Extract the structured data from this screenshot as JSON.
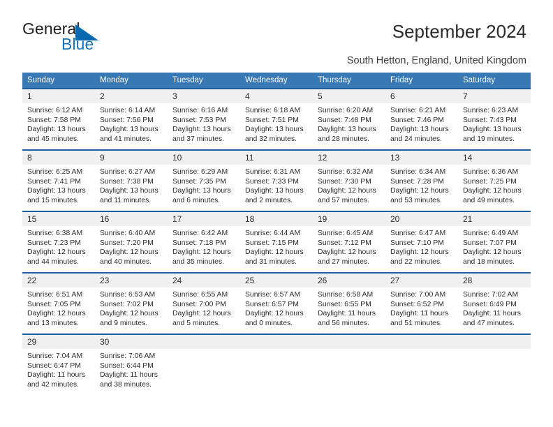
{
  "logo": {
    "word1": "General",
    "word2": "Blue",
    "icon": "triangle-icon"
  },
  "header": {
    "title": "September 2024",
    "subtitle": "South Hetton, England, United Kingdom"
  },
  "colors": {
    "header_blue": "#3878b4",
    "cell_border_blue": "#1c5f9e",
    "daynum_bg": "#f0f0f0",
    "logo_blue": "#1473bf",
    "text": "#2b2b2b"
  },
  "weekday_headers": [
    "Sunday",
    "Monday",
    "Tuesday",
    "Wednesday",
    "Thursday",
    "Friday",
    "Saturday"
  ],
  "labels": {
    "sunrise": "Sunrise:",
    "sunset": "Sunset:",
    "daylight": "Daylight:"
  },
  "weeks": [
    [
      {
        "day": "1",
        "sunrise": "Sunrise: 6:12 AM",
        "sunset": "Sunset: 7:58 PM",
        "daylight1": "Daylight: 13 hours",
        "daylight2": "and 45 minutes."
      },
      {
        "day": "2",
        "sunrise": "Sunrise: 6:14 AM",
        "sunset": "Sunset: 7:56 PM",
        "daylight1": "Daylight: 13 hours",
        "daylight2": "and 41 minutes."
      },
      {
        "day": "3",
        "sunrise": "Sunrise: 6:16 AM",
        "sunset": "Sunset: 7:53 PM",
        "daylight1": "Daylight: 13 hours",
        "daylight2": "and 37 minutes."
      },
      {
        "day": "4",
        "sunrise": "Sunrise: 6:18 AM",
        "sunset": "Sunset: 7:51 PM",
        "daylight1": "Daylight: 13 hours",
        "daylight2": "and 32 minutes."
      },
      {
        "day": "5",
        "sunrise": "Sunrise: 6:20 AM",
        "sunset": "Sunset: 7:48 PM",
        "daylight1": "Daylight: 13 hours",
        "daylight2": "and 28 minutes."
      },
      {
        "day": "6",
        "sunrise": "Sunrise: 6:21 AM",
        "sunset": "Sunset: 7:46 PM",
        "daylight1": "Daylight: 13 hours",
        "daylight2": "and 24 minutes."
      },
      {
        "day": "7",
        "sunrise": "Sunrise: 6:23 AM",
        "sunset": "Sunset: 7:43 PM",
        "daylight1": "Daylight: 13 hours",
        "daylight2": "and 19 minutes."
      }
    ],
    [
      {
        "day": "8",
        "sunrise": "Sunrise: 6:25 AM",
        "sunset": "Sunset: 7:41 PM",
        "daylight1": "Daylight: 13 hours",
        "daylight2": "and 15 minutes."
      },
      {
        "day": "9",
        "sunrise": "Sunrise: 6:27 AM",
        "sunset": "Sunset: 7:38 PM",
        "daylight1": "Daylight: 13 hours",
        "daylight2": "and 11 minutes."
      },
      {
        "day": "10",
        "sunrise": "Sunrise: 6:29 AM",
        "sunset": "Sunset: 7:35 PM",
        "daylight1": "Daylight: 13 hours",
        "daylight2": "and 6 minutes."
      },
      {
        "day": "11",
        "sunrise": "Sunrise: 6:31 AM",
        "sunset": "Sunset: 7:33 PM",
        "daylight1": "Daylight: 13 hours",
        "daylight2": "and 2 minutes."
      },
      {
        "day": "12",
        "sunrise": "Sunrise: 6:32 AM",
        "sunset": "Sunset: 7:30 PM",
        "daylight1": "Daylight: 12 hours",
        "daylight2": "and 57 minutes."
      },
      {
        "day": "13",
        "sunrise": "Sunrise: 6:34 AM",
        "sunset": "Sunset: 7:28 PM",
        "daylight1": "Daylight: 12 hours",
        "daylight2": "and 53 minutes."
      },
      {
        "day": "14",
        "sunrise": "Sunrise: 6:36 AM",
        "sunset": "Sunset: 7:25 PM",
        "daylight1": "Daylight: 12 hours",
        "daylight2": "and 49 minutes."
      }
    ],
    [
      {
        "day": "15",
        "sunrise": "Sunrise: 6:38 AM",
        "sunset": "Sunset: 7:23 PM",
        "daylight1": "Daylight: 12 hours",
        "daylight2": "and 44 minutes."
      },
      {
        "day": "16",
        "sunrise": "Sunrise: 6:40 AM",
        "sunset": "Sunset: 7:20 PM",
        "daylight1": "Daylight: 12 hours",
        "daylight2": "and 40 minutes."
      },
      {
        "day": "17",
        "sunrise": "Sunrise: 6:42 AM",
        "sunset": "Sunset: 7:18 PM",
        "daylight1": "Daylight: 12 hours",
        "daylight2": "and 35 minutes."
      },
      {
        "day": "18",
        "sunrise": "Sunrise: 6:44 AM",
        "sunset": "Sunset: 7:15 PM",
        "daylight1": "Daylight: 12 hours",
        "daylight2": "and 31 minutes."
      },
      {
        "day": "19",
        "sunrise": "Sunrise: 6:45 AM",
        "sunset": "Sunset: 7:12 PM",
        "daylight1": "Daylight: 12 hours",
        "daylight2": "and 27 minutes."
      },
      {
        "day": "20",
        "sunrise": "Sunrise: 6:47 AM",
        "sunset": "Sunset: 7:10 PM",
        "daylight1": "Daylight: 12 hours",
        "daylight2": "and 22 minutes."
      },
      {
        "day": "21",
        "sunrise": "Sunrise: 6:49 AM",
        "sunset": "Sunset: 7:07 PM",
        "daylight1": "Daylight: 12 hours",
        "daylight2": "and 18 minutes."
      }
    ],
    [
      {
        "day": "22",
        "sunrise": "Sunrise: 6:51 AM",
        "sunset": "Sunset: 7:05 PM",
        "daylight1": "Daylight: 12 hours",
        "daylight2": "and 13 minutes."
      },
      {
        "day": "23",
        "sunrise": "Sunrise: 6:53 AM",
        "sunset": "Sunset: 7:02 PM",
        "daylight1": "Daylight: 12 hours",
        "daylight2": "and 9 minutes."
      },
      {
        "day": "24",
        "sunrise": "Sunrise: 6:55 AM",
        "sunset": "Sunset: 7:00 PM",
        "daylight1": "Daylight: 12 hours",
        "daylight2": "and 5 minutes."
      },
      {
        "day": "25",
        "sunrise": "Sunrise: 6:57 AM",
        "sunset": "Sunset: 6:57 PM",
        "daylight1": "Daylight: 12 hours",
        "daylight2": "and 0 minutes."
      },
      {
        "day": "26",
        "sunrise": "Sunrise: 6:58 AM",
        "sunset": "Sunset: 6:55 PM",
        "daylight1": "Daylight: 11 hours",
        "daylight2": "and 56 minutes."
      },
      {
        "day": "27",
        "sunrise": "Sunrise: 7:00 AM",
        "sunset": "Sunset: 6:52 PM",
        "daylight1": "Daylight: 11 hours",
        "daylight2": "and 51 minutes."
      },
      {
        "day": "28",
        "sunrise": "Sunrise: 7:02 AM",
        "sunset": "Sunset: 6:49 PM",
        "daylight1": "Daylight: 11 hours",
        "daylight2": "and 47 minutes."
      }
    ],
    [
      {
        "day": "29",
        "sunrise": "Sunrise: 7:04 AM",
        "sunset": "Sunset: 6:47 PM",
        "daylight1": "Daylight: 11 hours",
        "daylight2": "and 42 minutes."
      },
      {
        "day": "30",
        "sunrise": "Sunrise: 7:06 AM",
        "sunset": "Sunset: 6:44 PM",
        "daylight1": "Daylight: 11 hours",
        "daylight2": "and 38 minutes."
      },
      {
        "day": "",
        "sunrise": "",
        "sunset": "",
        "daylight1": "",
        "daylight2": ""
      },
      {
        "day": "",
        "sunrise": "",
        "sunset": "",
        "daylight1": "",
        "daylight2": ""
      },
      {
        "day": "",
        "sunrise": "",
        "sunset": "",
        "daylight1": "",
        "daylight2": ""
      },
      {
        "day": "",
        "sunrise": "",
        "sunset": "",
        "daylight1": "",
        "daylight2": ""
      },
      {
        "day": "",
        "sunrise": "",
        "sunset": "",
        "daylight1": "",
        "daylight2": ""
      }
    ]
  ]
}
